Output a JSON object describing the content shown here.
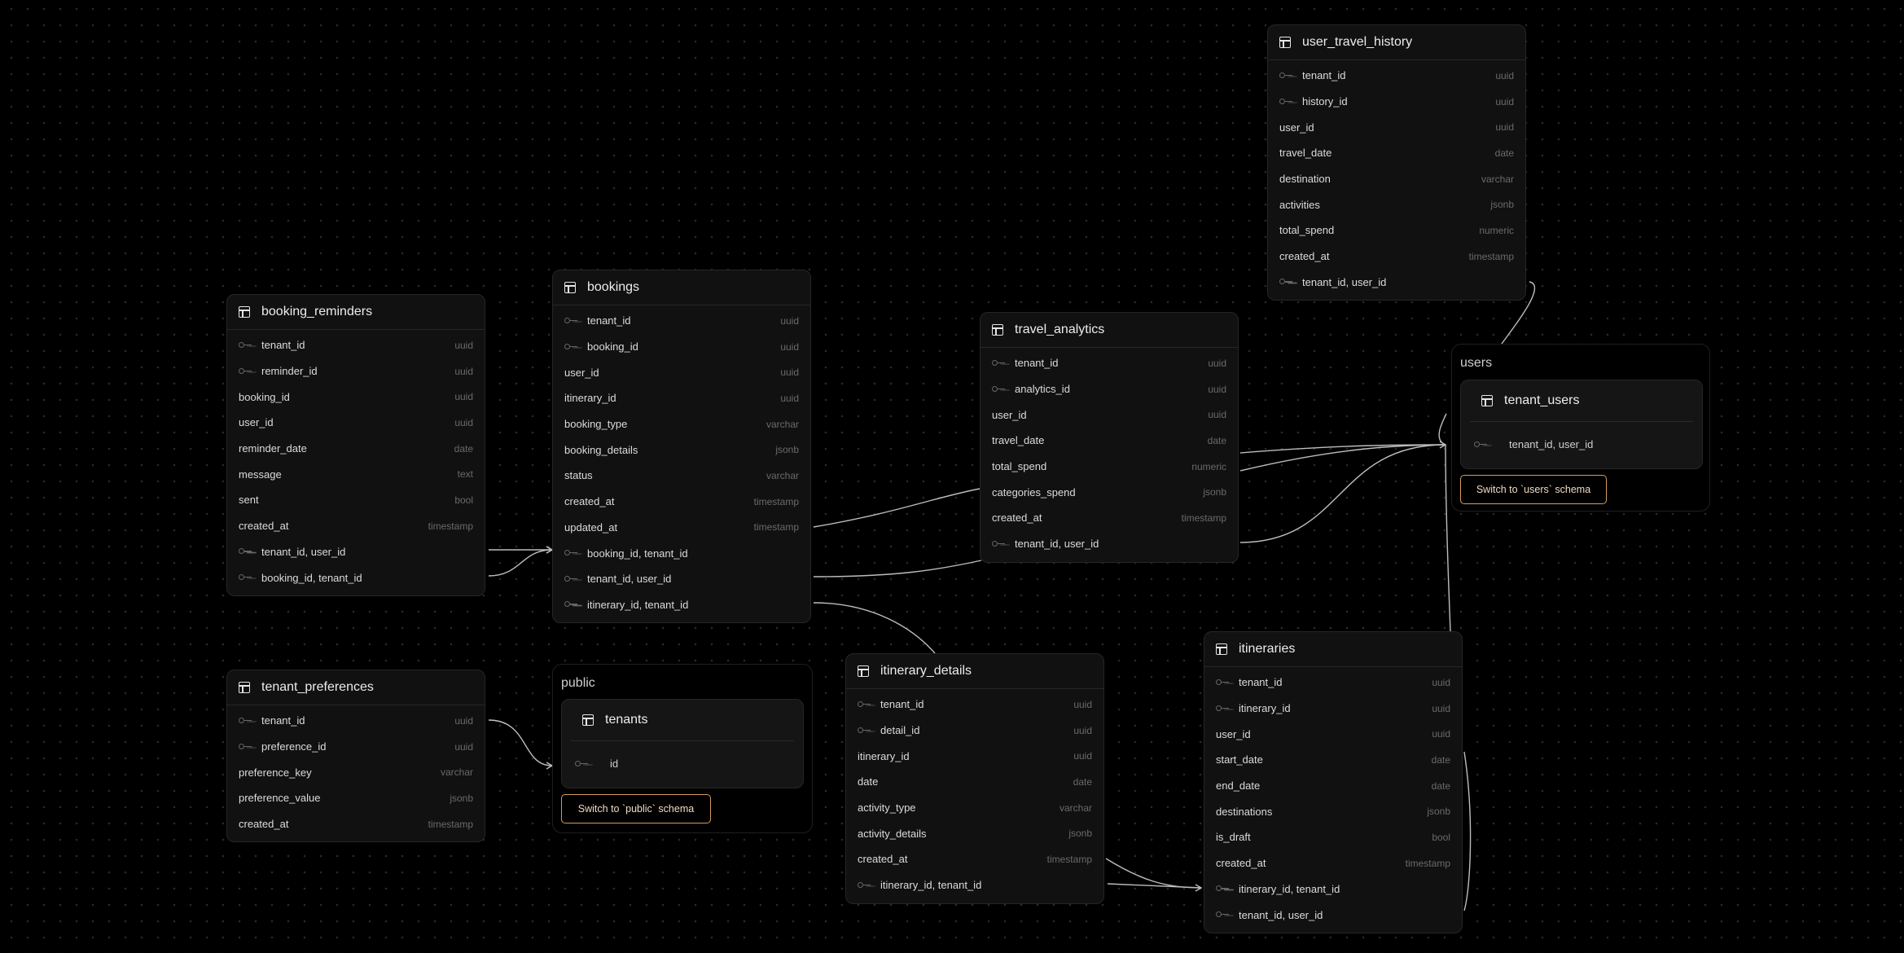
{
  "tables": {
    "booking_reminders": {
      "name": "booking_reminders",
      "columns": [
        {
          "name": "tenant_id",
          "type": "uuid",
          "key": true
        },
        {
          "name": "reminder_id",
          "type": "uuid",
          "key": true
        },
        {
          "name": "booking_id",
          "type": "uuid",
          "key": false
        },
        {
          "name": "user_id",
          "type": "uuid",
          "key": false
        },
        {
          "name": "reminder_date",
          "type": "date",
          "key": false
        },
        {
          "name": "message",
          "type": "text",
          "key": false
        },
        {
          "name": "sent",
          "type": "bool",
          "key": false
        },
        {
          "name": "created_at",
          "type": "timestamp",
          "key": false
        },
        {
          "name": "tenant_id, user_id",
          "type": "",
          "key": true
        },
        {
          "name": "booking_id, tenant_id",
          "type": "",
          "key": true
        }
      ]
    },
    "bookings": {
      "name": "bookings",
      "columns": [
        {
          "name": "tenant_id",
          "type": "uuid",
          "key": true
        },
        {
          "name": "booking_id",
          "type": "uuid",
          "key": true
        },
        {
          "name": "user_id",
          "type": "uuid",
          "key": false
        },
        {
          "name": "itinerary_id",
          "type": "uuid",
          "key": false
        },
        {
          "name": "booking_type",
          "type": "varchar",
          "key": false
        },
        {
          "name": "booking_details",
          "type": "jsonb",
          "key": false
        },
        {
          "name": "status",
          "type": "varchar",
          "key": false
        },
        {
          "name": "created_at",
          "type": "timestamp",
          "key": false
        },
        {
          "name": "updated_at",
          "type": "timestamp",
          "key": false
        },
        {
          "name": "booking_id, tenant_id",
          "type": "",
          "key": true
        },
        {
          "name": "tenant_id, user_id",
          "type": "",
          "key": true
        },
        {
          "name": "itinerary_id, tenant_id",
          "type": "",
          "key": true
        }
      ]
    },
    "travel_analytics": {
      "name": "travel_analytics",
      "columns": [
        {
          "name": "tenant_id",
          "type": "uuid",
          "key": true
        },
        {
          "name": "analytics_id",
          "type": "uuid",
          "key": true
        },
        {
          "name": "user_id",
          "type": "uuid",
          "key": false
        },
        {
          "name": "travel_date",
          "type": "date",
          "key": false
        },
        {
          "name": "total_spend",
          "type": "numeric",
          "key": false
        },
        {
          "name": "categories_spend",
          "type": "jsonb",
          "key": false
        },
        {
          "name": "created_at",
          "type": "timestamp",
          "key": false
        },
        {
          "name": "tenant_id, user_id",
          "type": "",
          "key": true
        }
      ]
    },
    "user_travel_history": {
      "name": "user_travel_history",
      "columns": [
        {
          "name": "tenant_id",
          "type": "uuid",
          "key": true
        },
        {
          "name": "history_id",
          "type": "uuid",
          "key": true
        },
        {
          "name": "user_id",
          "type": "uuid",
          "key": false
        },
        {
          "name": "travel_date",
          "type": "date",
          "key": false
        },
        {
          "name": "destination",
          "type": "varchar",
          "key": false
        },
        {
          "name": "activities",
          "type": "jsonb",
          "key": false
        },
        {
          "name": "total_spend",
          "type": "numeric",
          "key": false
        },
        {
          "name": "created_at",
          "type": "timestamp",
          "key": false
        },
        {
          "name": "tenant_id, user_id",
          "type": "",
          "key": true
        }
      ]
    },
    "itineraries": {
      "name": "itineraries",
      "columns": [
        {
          "name": "tenant_id",
          "type": "uuid",
          "key": true
        },
        {
          "name": "itinerary_id",
          "type": "uuid",
          "key": true
        },
        {
          "name": "user_id",
          "type": "uuid",
          "key": false
        },
        {
          "name": "start_date",
          "type": "date",
          "key": false
        },
        {
          "name": "end_date",
          "type": "date",
          "key": false
        },
        {
          "name": "destinations",
          "type": "jsonb",
          "key": false
        },
        {
          "name": "is_draft",
          "type": "bool",
          "key": false
        },
        {
          "name": "created_at",
          "type": "timestamp",
          "key": false
        },
        {
          "name": "itinerary_id, tenant_id",
          "type": "",
          "key": true
        },
        {
          "name": "tenant_id, user_id",
          "type": "",
          "key": true
        }
      ]
    },
    "itinerary_details": {
      "name": "itinerary_details",
      "columns": [
        {
          "name": "tenant_id",
          "type": "uuid",
          "key": true
        },
        {
          "name": "detail_id",
          "type": "uuid",
          "key": true
        },
        {
          "name": "itinerary_id",
          "type": "uuid",
          "key": false
        },
        {
          "name": "date",
          "type": "date",
          "key": false
        },
        {
          "name": "activity_type",
          "type": "varchar",
          "key": false
        },
        {
          "name": "activity_details",
          "type": "jsonb",
          "key": false
        },
        {
          "name": "created_at",
          "type": "timestamp",
          "key": false
        },
        {
          "name": "itinerary_id, tenant_id",
          "type": "",
          "key": true
        }
      ]
    },
    "tenant_preferences": {
      "name": "tenant_preferences",
      "columns": [
        {
          "name": "tenant_id",
          "type": "uuid",
          "key": true
        },
        {
          "name": "preference_id",
          "type": "uuid",
          "key": true
        },
        {
          "name": "preference_key",
          "type": "varchar",
          "key": false
        },
        {
          "name": "preference_value",
          "type": "jsonb",
          "key": false
        },
        {
          "name": "created_at",
          "type": "timestamp",
          "key": false
        }
      ]
    }
  },
  "schemas": {
    "public": {
      "title": "public",
      "table_name": "tenants",
      "key_label": "id",
      "switch_label": "Switch to `public` schema"
    },
    "users": {
      "title": "users",
      "table_name": "tenant_users",
      "key_label": "tenant_id, user_id",
      "switch_label": "Switch to `users` schema"
    }
  },
  "colors": {
    "background": "#000000",
    "table_bg": "#111111",
    "edge": "#bdbdbd",
    "switch_border": "#d89a5e"
  }
}
